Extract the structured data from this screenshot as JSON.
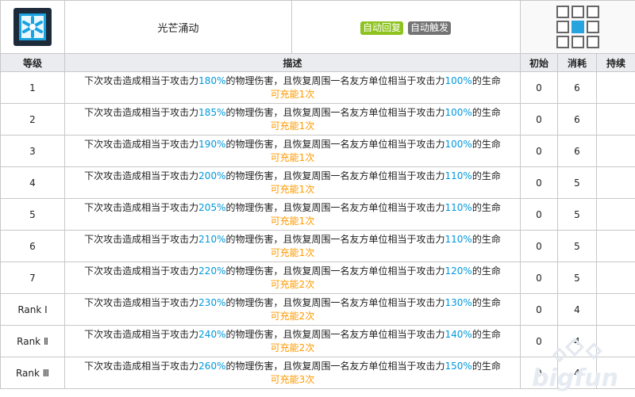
{
  "skill": {
    "name": "光芒涌动",
    "icon": "skill-icon",
    "badges": [
      {
        "label": "自动回复",
        "color": "#8ec31f"
      },
      {
        "label": "自动触发",
        "color": "#737373"
      }
    ],
    "range_icon": "range-grid-icon"
  },
  "columns": {
    "level": "等级",
    "desc": "描述",
    "initial": "初始",
    "cost": "消耗",
    "duration": "持续"
  },
  "desc_text": {
    "p1": "下次攻击造成相当于攻击力",
    "p2": "的物理伤害，且恢复周围一名友方单位相当于攻击力",
    "p3": "的生命",
    "charge_pre": "可充能",
    "charge_post": "次"
  },
  "levels": [
    {
      "level": "1",
      "atk": "180%",
      "heal": "100%",
      "charges": "1",
      "initial": "0",
      "cost": "6",
      "duration": ""
    },
    {
      "level": "2",
      "atk": "185%",
      "heal": "100%",
      "charges": "1",
      "initial": "0",
      "cost": "6",
      "duration": ""
    },
    {
      "level": "3",
      "atk": "190%",
      "heal": "100%",
      "charges": "1",
      "initial": "0",
      "cost": "6",
      "duration": ""
    },
    {
      "level": "4",
      "atk": "200%",
      "heal": "110%",
      "charges": "1",
      "initial": "0",
      "cost": "5",
      "duration": ""
    },
    {
      "level": "5",
      "atk": "205%",
      "heal": "110%",
      "charges": "1",
      "initial": "0",
      "cost": "5",
      "duration": ""
    },
    {
      "level": "6",
      "atk": "210%",
      "heal": "110%",
      "charges": "1",
      "initial": "0",
      "cost": "5",
      "duration": ""
    },
    {
      "level": "7",
      "atk": "220%",
      "heal": "120%",
      "charges": "2",
      "initial": "0",
      "cost": "5",
      "duration": ""
    },
    {
      "level": "Rank Ⅰ",
      "atk": "230%",
      "heal": "130%",
      "charges": "2",
      "initial": "0",
      "cost": "4",
      "duration": ""
    },
    {
      "level": "Rank Ⅱ",
      "atk": "240%",
      "heal": "140%",
      "charges": "2",
      "initial": "0",
      "cost": "4",
      "duration": ""
    },
    {
      "level": "Rank Ⅲ",
      "atk": "260%",
      "heal": "150%",
      "charges": "3",
      "initial": "0",
      "cost": "4",
      "duration": ""
    }
  ],
  "colors": {
    "highlight": "#0098dc",
    "charge": "#ff9a00",
    "range_on": "#27a3dd",
    "header_bg": "#eaecf0"
  },
  "watermark": {
    "text": "bigfun"
  }
}
